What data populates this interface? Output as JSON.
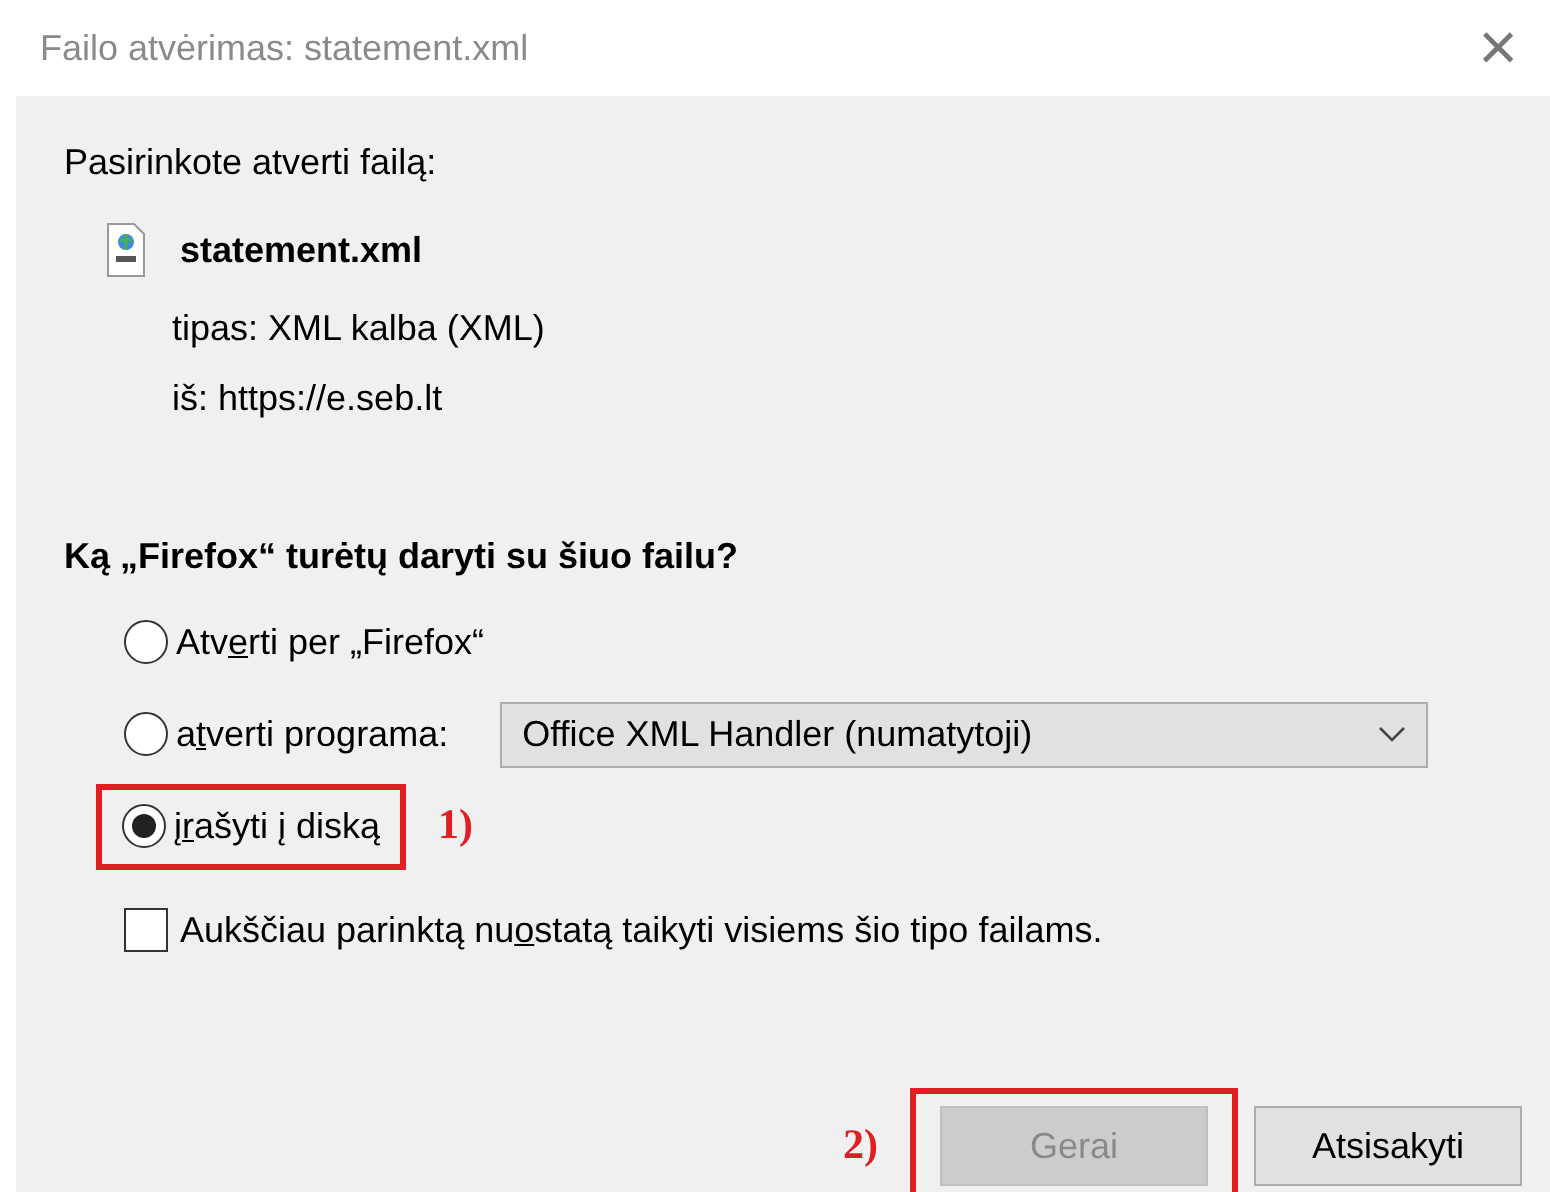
{
  "window": {
    "title": "Failo atvėrimas: statement.xml",
    "close_glyph": "×"
  },
  "intro": "Pasirinkote atverti failą:",
  "file": {
    "name": "statement.xml",
    "type_label": "tipas:",
    "type_value": "XML kalba (XML)",
    "from_label": "iš:",
    "from_value": "https://e.seb.lt"
  },
  "question": "Ką „Firefox“ turėtų daryti su šiuo failu?",
  "options": [
    {
      "kind": "radio",
      "label_before": "Atv",
      "access_key": "e",
      "label_after": "rti per „Firefox“",
      "selected": false
    },
    {
      "kind": "radio_with_select",
      "label_before": "a",
      "access_key": "t",
      "label_after": "verti programa:",
      "selected": false,
      "select_value": "Office XML Handler (numatytoji)"
    },
    {
      "kind": "radio",
      "label_before": "į",
      "access_key": "r",
      "label_after": "ašyti į diską",
      "selected": true,
      "annotation": "1)"
    }
  ],
  "remember": {
    "label_before": "Aukščiau parinktą nu",
    "access_key": "o",
    "label_after": "statą taikyti visiems šio tipo failams.",
    "checked": false
  },
  "buttons": [
    {
      "label": "Gerai",
      "disabled": true,
      "annotation": "2)"
    },
    {
      "label": "Atsisakyti",
      "disabled": false
    }
  ]
}
